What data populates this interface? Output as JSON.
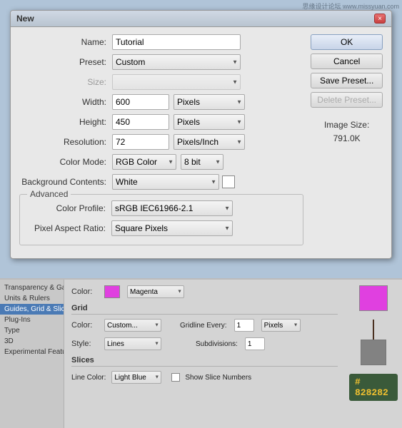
{
  "watermark": "思缘设计论坛  www.missyuan.com",
  "dialog": {
    "title": "New",
    "close_label": "×",
    "name_label": "Name:",
    "name_value": "Tutorial",
    "preset_label": "Preset:",
    "preset_value": "Custom",
    "size_label": "Size:",
    "width_label": "Width:",
    "width_value": "600",
    "width_unit": "Pixels",
    "height_label": "Height:",
    "height_value": "450",
    "height_unit": "Pixels",
    "resolution_label": "Resolution:",
    "resolution_value": "72",
    "resolution_unit": "Pixels/Inch",
    "colormode_label": "Color Mode:",
    "colormode_value": "RGB Color",
    "colormode_bit": "8 bit",
    "bg_label": "Background Contents:",
    "bg_value": "White",
    "advanced_title": "Advanced",
    "colorprofile_label": "Color Profile:",
    "colorprofile_value": "sRGB IEC61966-2.1",
    "pixelaspect_label": "Pixel Aspect Ratio:",
    "pixelaspect_value": "Square Pixels",
    "image_size_label": "Image Size:",
    "image_size_value": "791.0K",
    "btn_ok": "OK",
    "btn_cancel": "Cancel",
    "btn_save_preset": "Save Preset...",
    "btn_delete_preset": "Delete Preset..."
  },
  "bottom": {
    "sidebar_items": [
      "Transparency & Gamut",
      "Units & Rulers",
      "Guides, Grid & Slices",
      "Plug-Ins",
      "Type",
      "3D",
      "Experimental Features"
    ],
    "active_item": "Guides, Grid & Slices",
    "color_label": "Color:",
    "color_value": "Magenta",
    "grid_title": "Grid",
    "grid_color_label": "Color:",
    "grid_color_value": "Custom...",
    "grid_style_label": "Style:",
    "grid_style_value": "Lines",
    "gridline_label": "Gridline Every:",
    "gridline_value": "1",
    "gridline_unit": "Pixels",
    "subdivisions_label": "Subdivisions:",
    "subdivisions_value": "1",
    "slices_title": "Slices",
    "slice_color_label": "Line Color:",
    "slice_color_value": "Light Blue",
    "slice_show_label": "Show Slice Numbers",
    "hash_value": "# 828282"
  }
}
